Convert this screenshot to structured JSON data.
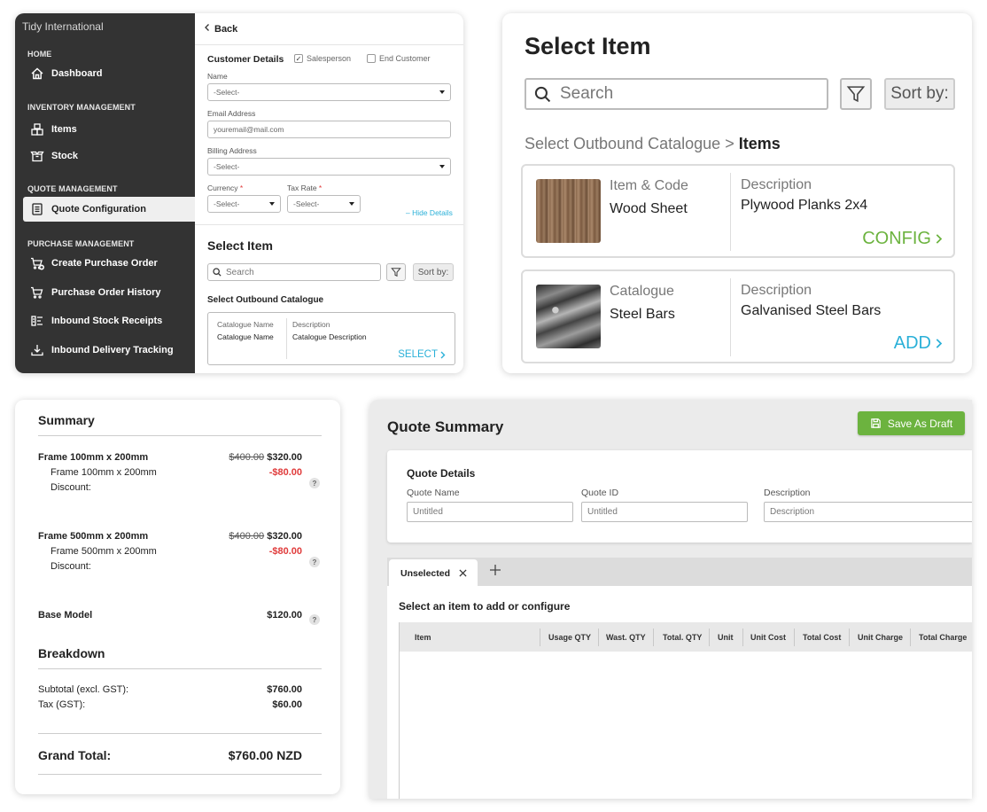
{
  "sidebar": {
    "brand": "Tidy International",
    "sections": {
      "home": "HOME",
      "inventory": "INVENTORY MANAGEMENT",
      "quote": "QUOTE MANAGEMENT",
      "purchase": "PURCHASE MANAGEMENT"
    },
    "items": {
      "dashboard": "Dashboard",
      "items": "Items",
      "stock": "Stock",
      "quote_config": "Quote Configuration",
      "create_po": "Create Purchase Order",
      "po_history": "Purchase Order History",
      "inbound_receipts": "Inbound Stock Receipts",
      "inbound_tracking": "Inbound Delivery Tracking"
    }
  },
  "customer": {
    "back": "Back",
    "title": "Customer Details",
    "salesperson": "Salesperson",
    "end_customer": "End Customer",
    "name_label": "Name",
    "name_value": "-Select-",
    "email_label": "Email Address",
    "email_placeholder": "youremail@mail.com",
    "billing_label": "Billing Address",
    "billing_value": "-Select-",
    "currency_label": "Currency",
    "currency_value": "-Select-",
    "tax_label": "Tax Rate",
    "tax_value": "-Select-",
    "req": "*",
    "hide_details": "– Hide Details"
  },
  "mini_select": {
    "title": "Select Item",
    "search_placeholder": "Search",
    "sort": "Sort by:",
    "catalogue_title": "Select Outbound Catalogue",
    "col1_label": "Catalogue Name",
    "col1_value": "Catalogue Name",
    "col2_label": "Description",
    "col2_value": "Catalogue Description",
    "action": "SELECT"
  },
  "select_item": {
    "title": "Select Item",
    "search_placeholder": "Search",
    "sort": "Sort by:",
    "breadcrumb_parent": "Select Outbound Catalogue",
    "breadcrumb_sep": ">",
    "breadcrumb_current": "Items",
    "cards": [
      {
        "label1": "Item & Code",
        "value1": "Wood Sheet",
        "label2": "Description",
        "value2": "Plywood Planks 2x4",
        "action": "CONFIG",
        "action_color": "#6cb33f"
      },
      {
        "label1": "Catalogue",
        "value1": "Steel Bars",
        "label2": "Description",
        "value2": "Galvanised Steel Bars",
        "action": "ADD",
        "action_color": "#2ab0d8"
      }
    ]
  },
  "summary": {
    "title": "Summary",
    "lines": [
      {
        "name": "Frame 100mm x 200mm",
        "sub": "Frame 100mm x 200mm",
        "discount_label": "Discount:",
        "old_price": "$400.00",
        "price": "$320.00",
        "discount": "-$80.00"
      },
      {
        "name": "Frame 500mm x 200mm",
        "sub": "Frame 500mm x 200mm",
        "discount_label": "Discount:",
        "old_price": "$400.00",
        "price": "$320.00",
        "discount": "-$80.00"
      }
    ],
    "base_label": "Base Model",
    "base_price": "$120.00",
    "help": "?",
    "breakdown_title": "Breakdown",
    "subtotal_label": "Subtotal (excl. GST):",
    "subtotal_value": "$760.00",
    "tax_label": "Tax (GST):",
    "tax_value": "$60.00",
    "grand_label": "Grand Total:",
    "grand_value": "$760.00 NZD"
  },
  "quote": {
    "title": "Quote Summary",
    "save_button": "Save As Draft",
    "details_title": "Quote Details",
    "name_label": "Quote Name",
    "name_placeholder": "Untitled",
    "id_label": "Quote ID",
    "id_placeholder": "Untitled",
    "desc_label": "Description",
    "desc_placeholder": "Description",
    "tab_label": "Unselected",
    "prompt": "Select an item to add or configure",
    "columns": [
      "Item",
      "Usage QTY",
      "Wast. QTY",
      "Total. QTY",
      "Unit",
      "Unit Cost",
      "Total Cost",
      "Unit Charge",
      "Total Charge"
    ],
    "accent": "#6cb33f"
  }
}
